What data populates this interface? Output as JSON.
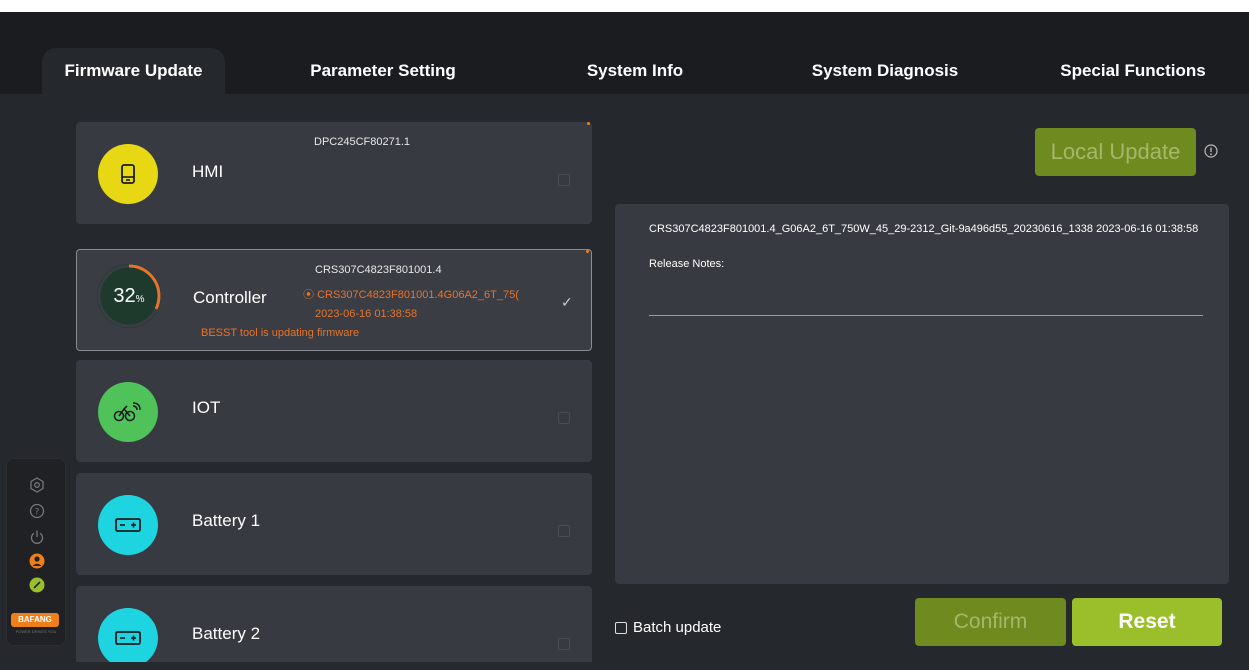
{
  "tabs": [
    {
      "label": "Firmware Update",
      "active": true
    },
    {
      "label": "Parameter Setting",
      "active": false
    },
    {
      "label": "System Info",
      "active": false
    },
    {
      "label": "System Diagnosis",
      "active": false
    },
    {
      "label": "Special Functions",
      "active": false
    }
  ],
  "devices": [
    {
      "name": "HMI",
      "version": "DPC245CF80271.1",
      "icon": "display-icon",
      "color": "#e8d814"
    },
    {
      "name": "Controller",
      "version": "CRS307C4823F801001.4",
      "target": "CRS307C4823F801001.4G06A2_6T_75(",
      "date": "2023-06-16 01:38:58",
      "status": "BESST tool is updating firmware",
      "progress": 32,
      "progress_unit": "%",
      "selected": true,
      "check": "✓"
    },
    {
      "name": "IOT",
      "icon": "bike-iot-icon",
      "color": "#4fc25a"
    },
    {
      "name": "Battery 1",
      "icon": "battery-icon",
      "color": "#1ed4e0"
    },
    {
      "name": "Battery 2",
      "icon": "battery-icon",
      "color": "#1ed4e0"
    }
  ],
  "detail": {
    "info": "CRS307C4823F801001.4_G06A2_6T_750W_45_29-2312_Git-9a496d55_20230616_1338 2023-06-16 01:38:58",
    "notes_label": "Release Notes:"
  },
  "buttons": {
    "local_update": "Local Update",
    "confirm": "Confirm",
    "reset": "Reset",
    "batch_update": "Batch update"
  },
  "brand": {
    "name": "BAFANG",
    "tagline": "POWER DRIVES YOU",
    "color": "#ef7f1a"
  },
  "colors": {
    "accent_green": "#9bbf2a",
    "disabled_green": "#6f8a1f",
    "progress_orange": "#e8732c"
  }
}
